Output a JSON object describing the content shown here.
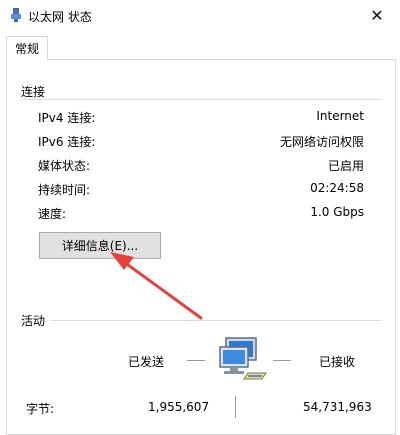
{
  "window": {
    "title": "以太网 状态",
    "close_glyph": "✕"
  },
  "tabs": [
    {
      "label": "常规"
    }
  ],
  "connection": {
    "heading": "连接",
    "rows": [
      {
        "label": "IPv4 连接:",
        "value": "Internet"
      },
      {
        "label": "IPv6 连接:",
        "value": "无网络访问权限"
      },
      {
        "label": "媒体状态:",
        "value": "已启用"
      },
      {
        "label": "持续时间:",
        "value": "02:24:58"
      },
      {
        "label": "速度:",
        "value": "1.0 Gbps"
      }
    ],
    "details_button": "详细信息(E)..."
  },
  "activity": {
    "heading": "活动",
    "sent_label": "已发送",
    "received_label": "已接收",
    "bytes_label": "字节:",
    "bytes_sent": "1,955,607",
    "bytes_received": "54,731,963"
  },
  "colors": {
    "annotation_arrow": "#e8413b",
    "border": "#d9d9d9",
    "button_bg": "#e1e1e1"
  }
}
